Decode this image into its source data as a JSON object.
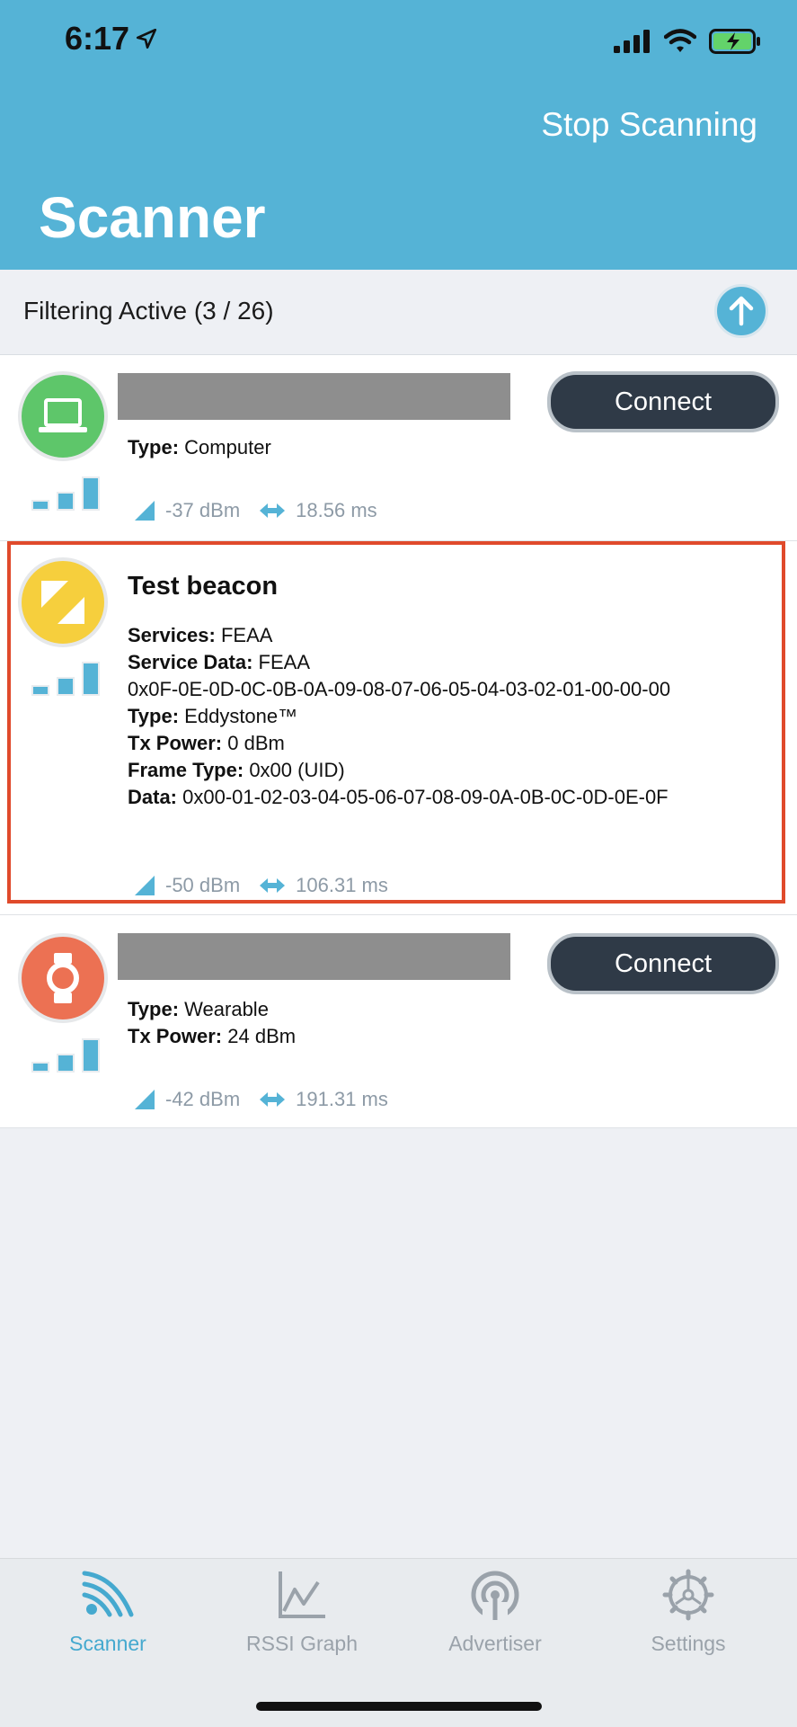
{
  "status": {
    "time": "6:17"
  },
  "header": {
    "stop_label": "Stop Scanning",
    "title": "Scanner"
  },
  "filter": {
    "label": "Filtering Active (3 / 26)"
  },
  "devices": [
    {
      "type_label": "Type:",
      "type_value": "Computer",
      "connect_label": "Connect",
      "rssi": "-37 dBm",
      "interval": "18.56 ms",
      "avatar_color": "#5ec66a"
    },
    {
      "name": "Test beacon",
      "services_label": "Services:",
      "services_value": "FEAA",
      "service_data_label": "Service Data:",
      "service_data_value": "FEAA",
      "service_data_hex": "0x0F-0E-0D-0C-0B-0A-09-08-07-06-05-04-03-02-01-00-00-00",
      "type_label": "Type:",
      "type_value": "Eddystone™",
      "tx_label": "Tx Power:",
      "tx_value": "0 dBm",
      "frame_label": "Frame Type:",
      "frame_value": "0x00 (UID)",
      "data_label": "Data:",
      "data_value": "0x00-01-02-03-04-05-06-07-08-09-0A-0B-0C-0D-0E-0F",
      "rssi": "-50 dBm",
      "interval": "106.31 ms",
      "avatar_color": "#f6cf3d"
    },
    {
      "type_label": "Type:",
      "type_value": "Wearable",
      "tx_label": "Tx Power:",
      "tx_value": "24 dBm",
      "connect_label": "Connect",
      "rssi": "-42 dBm",
      "interval": "191.31 ms",
      "avatar_color": "#ec7153"
    }
  ],
  "tabs": [
    {
      "label": "Scanner",
      "icon": "scanner-icon",
      "active": true
    },
    {
      "label": "RSSI Graph",
      "icon": "graph-icon",
      "active": false
    },
    {
      "label": "Advertiser",
      "icon": "advertiser-icon",
      "active": false
    },
    {
      "label": "Settings",
      "icon": "settings-icon",
      "active": false
    }
  ],
  "colors": {
    "accent": "#55b3d6",
    "highlight": "#e04a2b",
    "button_dark": "#2f3a47"
  }
}
